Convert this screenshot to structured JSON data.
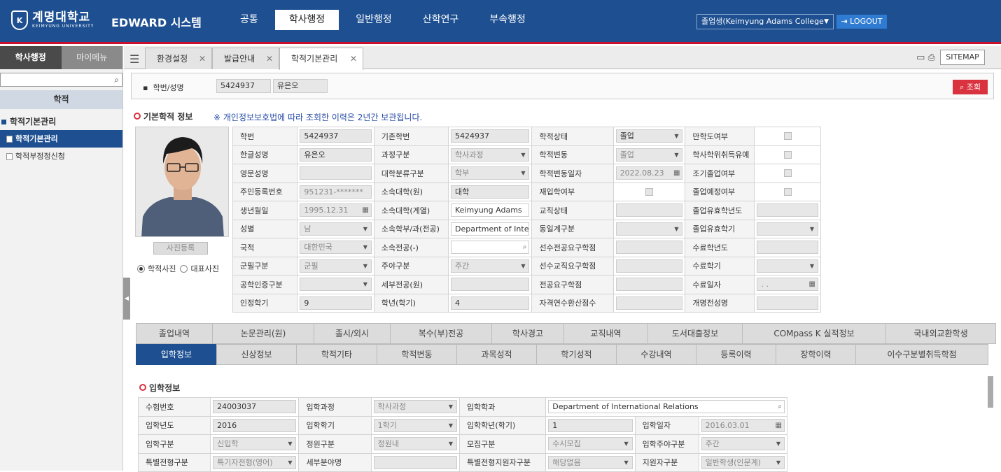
{
  "header": {
    "logo_emblem": "K",
    "logo_name": "계명대학교",
    "logo_sub": "KEIMYUNG UNIVERSITY",
    "system": "EDWARD 시스템",
    "nav": [
      "공통",
      "학사행정",
      "일반행정",
      "산학연구",
      "부속행정"
    ],
    "nav_active": 1,
    "user_select": "졸업생(Keimyung Adams College",
    "logout": "LOGOUT"
  },
  "left": {
    "tab_main": "학사행정",
    "tab_my": "마이메뉴",
    "section": "학적",
    "tree_parent": "학적기본관리",
    "tree_items": [
      "학적기본관리",
      "학적부정정신청"
    ]
  },
  "tabs": {
    "items": [
      "환경설정",
      "발급안내",
      "학적기본관리"
    ],
    "sitemap": "SITEMAP"
  },
  "search": {
    "label": "학번/성명",
    "student_id": "5424937",
    "name": "유은오",
    "button": "조회"
  },
  "basic": {
    "title": "기본학적 정보",
    "notice": "※ 개인정보보호법에 따라 조회한 이력은 2년간 보관됩니다.",
    "photo_button": "사진등록",
    "radio1": "학적사진",
    "radio2": "대표사진",
    "rows": [
      [
        "학번",
        "5424937",
        "기존학번",
        "5424937",
        "학적상태",
        "졸업",
        "만학도여부",
        ""
      ],
      [
        "한글성명",
        "유은오",
        "과정구분",
        "학사과정",
        "학적변동",
        "졸업",
        "학사학위취득유예",
        ""
      ],
      [
        "영문성명",
        "",
        "대학분류구분",
        "학부",
        "학적변동일자",
        "2022.08.23",
        "조기졸업여부",
        ""
      ],
      [
        "주민등록번호",
        "951231-*******",
        "소속대학(원)",
        "대학",
        "재입학여부",
        "",
        "졸업예정여부",
        ""
      ],
      [
        "생년월일",
        "1995.12.31",
        "소속대학(계열)",
        "Keimyung Adams",
        "교직상태",
        "",
        "졸업유효학년도",
        ""
      ],
      [
        "성별",
        "남",
        "소속학부/과(전공)",
        "Department of Inte",
        "동일계구분",
        "",
        "졸업유효학기",
        ""
      ],
      [
        "국적",
        "대한민국",
        "소속전공(-)",
        "",
        "선수전공요구학점",
        "",
        "수료학년도",
        ""
      ],
      [
        "군필구분",
        "군필",
        "주야구분",
        "주간",
        "선수교직요구학점",
        "",
        "수료학기",
        ""
      ],
      [
        "공학인증구분",
        "",
        "세부전공(원)",
        "",
        "전공요구학점",
        "",
        "수료일자",
        ". ."
      ],
      [
        "인정학기",
        "9",
        "학년(학기)",
        "4",
        "자격연수환산점수",
        "",
        "개명전성명",
        ""
      ]
    ]
  },
  "subtabs": {
    "row1": [
      "졸업내역",
      "논문관리(원)",
      "졸시/외시",
      "복수(부)전공",
      "학사경고",
      "교직내역",
      "도서대출정보",
      "COMpass K 실적정보",
      "국내외교환학생"
    ],
    "row2": [
      "입학정보",
      "신상정보",
      "학적기타",
      "학적변동",
      "과목성적",
      "학기성적",
      "수강내역",
      "등록이력",
      "장학이력",
      "이수구분별취득학점"
    ],
    "active": "입학정보"
  },
  "admission": {
    "title": "입학정보",
    "rows": [
      [
        "수험번호",
        "24003037",
        "입학과정",
        "학사과정",
        "입학학과",
        "Department of International Relations"
      ],
      [
        "입학년도",
        "2016",
        "입학학기",
        "1학기",
        "입학학년(학기)",
        "1",
        "입학일자",
        "2016.03.01"
      ],
      [
        "입학구분",
        "신입학",
        "정원구분",
        "정원내",
        "모집구분",
        "수시모집",
        "입학주야구분",
        "주간"
      ],
      [
        "특별전형구분",
        "특기자전형(영어)",
        "세부분야명",
        "",
        "특별전형지원자구분",
        "해당없음",
        "지원자구분",
        "일반학생(인문계)"
      ]
    ]
  }
}
